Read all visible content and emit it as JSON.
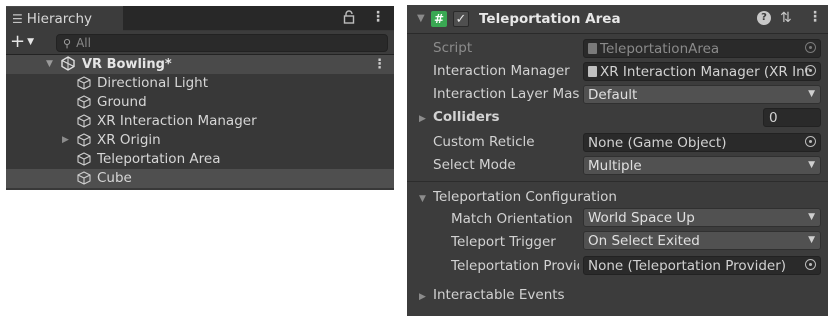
{
  "hierarchy": {
    "tab_label": "Hierarchy",
    "search_placeholder": "All",
    "scene_name": "VR Bowling*",
    "objects": [
      {
        "name": "Directional Light",
        "has_children": false
      },
      {
        "name": "Ground",
        "has_children": false
      },
      {
        "name": "XR Interaction Manager",
        "has_children": false
      },
      {
        "name": "XR Origin",
        "has_children": true
      },
      {
        "name": "Teleportation Area",
        "has_children": false
      },
      {
        "name": "Cube",
        "has_children": false,
        "selected": true
      }
    ]
  },
  "inspector": {
    "component_title": "Teleportation Area",
    "enabled": true,
    "fields": {
      "script": {
        "label": "Script",
        "value": "TeleportationArea"
      },
      "interaction_manager": {
        "label": "Interaction Manager",
        "value": "XR Interaction Manager (XR Int"
      },
      "interaction_layer_mask": {
        "label": "Interaction Layer Mask",
        "value": "Default"
      },
      "colliders": {
        "label": "Colliders",
        "value": "0"
      },
      "custom_reticle": {
        "label": "Custom Reticle",
        "value": "None (Game Object)"
      },
      "select_mode": {
        "label": "Select Mode",
        "value": "Multiple"
      }
    },
    "teleportation_configuration": {
      "label": "Teleportation Configuration",
      "match_orientation": {
        "label": "Match Orientation",
        "value": "World Space Up"
      },
      "teleport_trigger": {
        "label": "Teleport Trigger",
        "value": "On Select Exited"
      },
      "teleportation_provider": {
        "label": "Teleportation Provider",
        "value": "None (Teleportation Provider)"
      }
    },
    "interactable_events_label": "Interactable Events"
  },
  "colors": {
    "panel_bg": "#383838",
    "inspector_bg": "#3c3c3c",
    "script_badge": "#3aa853",
    "field_bg": "#2a2a2a",
    "dropdown_bg": "#515151"
  }
}
